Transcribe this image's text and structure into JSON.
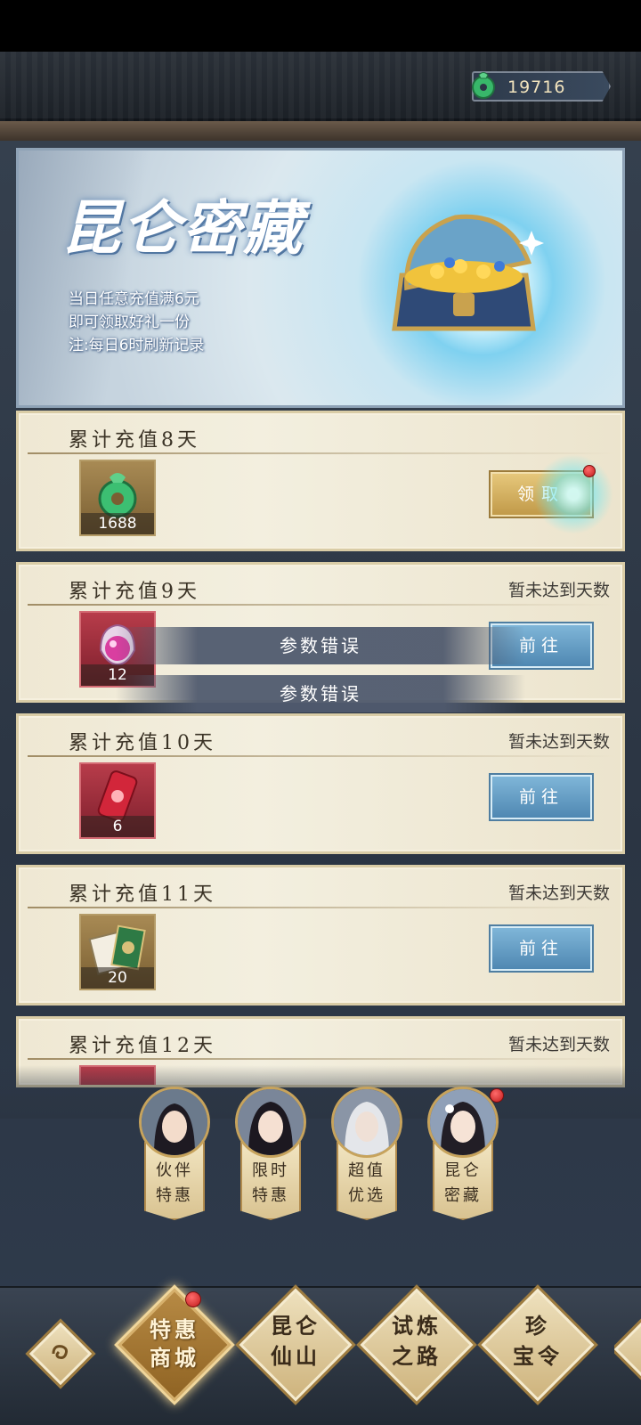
{
  "currency": {
    "icon": "jade-icon",
    "value": "19716"
  },
  "banner": {
    "title": "昆仑密藏",
    "lines": [
      "当日任意充值满6元",
      "即可领取好礼一份",
      "注:每日6时刷新记录"
    ]
  },
  "cards": [
    {
      "title": "累计充值8天",
      "status": "",
      "reward_count": "1688",
      "button": "领取"
    },
    {
      "title": "累计充值9天",
      "status": "暂未达到天数",
      "reward_count": "12",
      "button": "前往"
    },
    {
      "title": "累计充值10天",
      "status": "暂未达到天数",
      "reward_count": "6",
      "button": "前往"
    },
    {
      "title": "累计充值11天",
      "status": "暂未达到天数",
      "reward_count": "20",
      "button": "前往"
    },
    {
      "title": "累计充值12天",
      "status": "暂未达到天数"
    }
  ],
  "toasts": [
    "参数错误",
    "参数错误"
  ],
  "characters": [
    {
      "line1": "伙伴",
      "line2": "特惠"
    },
    {
      "line1": "限时",
      "line2": "特惠"
    },
    {
      "line1": "超值",
      "line2": "优选"
    },
    {
      "line1": "昆仑",
      "line2": "密藏"
    }
  ],
  "nav": [
    {
      "line1": "特惠",
      "line2": "商城"
    },
    {
      "line1": "昆仑",
      "line2": "仙山"
    },
    {
      "line1": "试炼",
      "line2": "之路"
    },
    {
      "line1": "珍",
      "line2": "宝令"
    }
  ],
  "colors": {
    "accent_gold": "#c19a49",
    "button_blue": "#4f88b2",
    "card_bg": "#efe8d3",
    "notify_red": "#c01b1b"
  }
}
